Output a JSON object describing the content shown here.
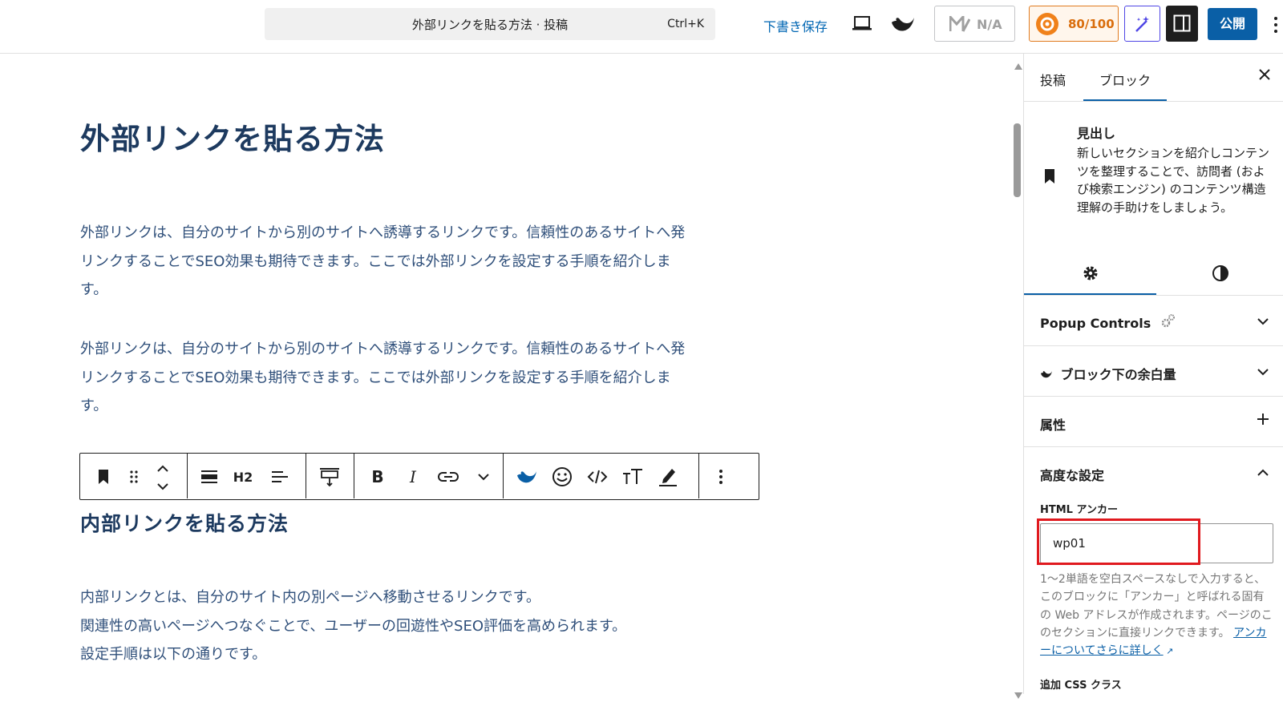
{
  "topbar": {
    "command_title": "外部リンクを貼る方法 · 投稿",
    "command_shortcut": "Ctrl+K",
    "save_draft": "下書き保存",
    "na_label": "N/A",
    "score": "80/100",
    "publish": "公開"
  },
  "editor": {
    "post_title": "外部リンクを貼る方法",
    "paragraph1": "外部リンクは、自分のサイトから別のサイトへ誘導するリンクです。信頼性のあるサイトへ発リンクすることでSEO効果も期待できます。ここでは外部リンクを設定する手順を紹介します。",
    "paragraph2": "外部リンクは、自分のサイトから別のサイトへ誘導するリンクです。信頼性のあるサイトへ発リンクすることでSEO効果も期待できます。ここでは外部リンクを設定する手順を紹介します。",
    "heading2": "内部リンクを貼る方法",
    "paragraph3_lines": [
      "内部リンクとは、自分のサイト内の別ページへ移動させるリンクです。",
      "関連性の高いページへつなぐことで、ユーザーの回遊性やSEO評価を高められます。",
      "設定手順は以下の通りです。"
    ],
    "toolbar": {
      "heading_level": "H2",
      "bold": "B",
      "italic": "I"
    }
  },
  "sidebar": {
    "tab_post": "投稿",
    "tab_block": "ブロック",
    "block_name": "見出し",
    "block_description": "新しいセクションを紹介しコンテンツを整理することで、訪問者 (および検索エンジン) のコンテンツ構造理解の手助けをしましょう。",
    "panels": {
      "popup_controls": "Popup Controls",
      "block_margin": "ブロック下の余白量",
      "attributes": "属性",
      "advanced": "高度な設定"
    },
    "html_anchor_label": "HTML アンカー",
    "html_anchor_value": "wp01",
    "help_text": "1〜2単語を空白スペースなしで入力すると、このブロックに「アンカー」と呼ばれる固有の Web アドレスが作成されます。ページのこのセクションに直接リンクできます。",
    "help_link": "アンカーについてさらに詳しく",
    "cut_label": "追加 CSS クラス"
  },
  "colors": {
    "accent": "#0a5fa6",
    "score_orange": "#d96d0c",
    "highlight_red": "#e0191e",
    "heading_navy": "#1d3a5f"
  }
}
